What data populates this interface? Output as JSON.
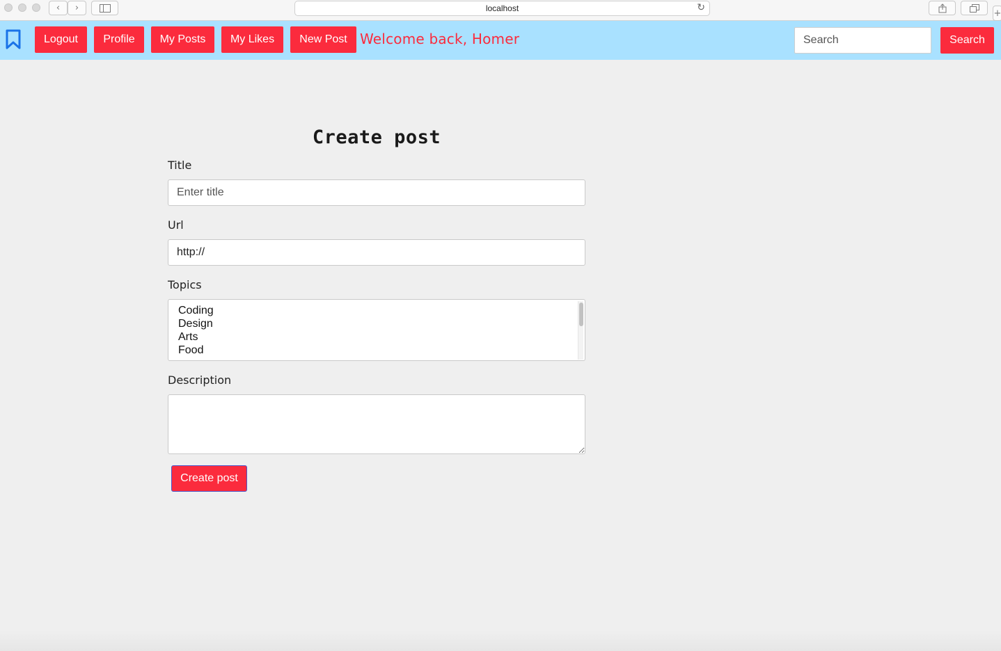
{
  "browser": {
    "address": "localhost",
    "reload_icon": "reload-icon",
    "back_icon": "chevron-left-icon",
    "forward_icon": "chevron-right-icon",
    "sidebar_icon": "sidebar-icon",
    "share_icon": "share-icon",
    "tabs_icon": "tabs-icon",
    "new_tab_icon": "plus-icon"
  },
  "navbar": {
    "brand_icon": "bookmark-icon",
    "buttons": [
      "Logout",
      "Profile",
      "My Posts",
      "My Likes",
      "New Post"
    ],
    "welcome": "Welcome back, Homer",
    "search_placeholder": "Search",
    "search_button": "Search",
    "colors": {
      "bar": "#a9e1ff",
      "accent": "#fb2b3d",
      "brand": "#1a73e8"
    }
  },
  "form": {
    "heading": "Create post",
    "title_label": "Title",
    "title_placeholder": "Enter title",
    "url_label": "Url",
    "url_value": "http://",
    "topics_label": "Topics",
    "topics": [
      "Coding",
      "Design",
      "Arts",
      "Food"
    ],
    "description_label": "Description",
    "description_value": "",
    "submit_label": "Create post"
  }
}
